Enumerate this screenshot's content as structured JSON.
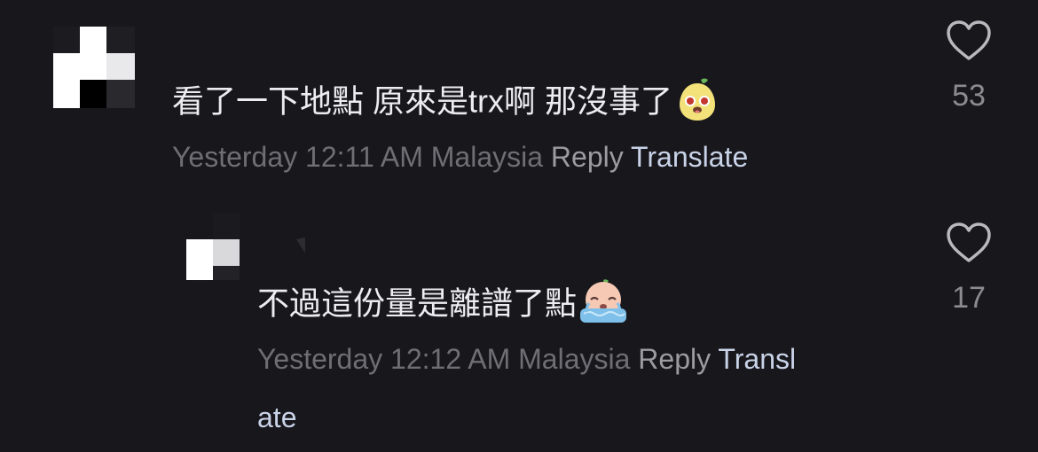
{
  "comments": [
    {
      "text": "看了一下地點 原來是trx啊 那沒事了",
      "emoji": "pear-face-emoji",
      "timestamp": "Yesterday 12:11 AM",
      "location": "Malaysia",
      "reply_label": "Reply",
      "translate_label": "Translate",
      "likes": "53"
    },
    {
      "text": "不過這份量是離譜了點",
      "emoji": "crying-face-emoji",
      "timestamp": "Yesterday 12:12 AM",
      "location": "Malaysia",
      "reply_label": "Reply",
      "translate_label_part1": "Transl",
      "translate_label_part2": "ate",
      "likes": "17"
    }
  ],
  "colors": {
    "background": "#18171c",
    "text": "#ededf0",
    "meta": "#6f6e75",
    "reply": "#9c9ba2",
    "translate": "#c9d3e8",
    "like_icon": "#b9b8bf"
  }
}
